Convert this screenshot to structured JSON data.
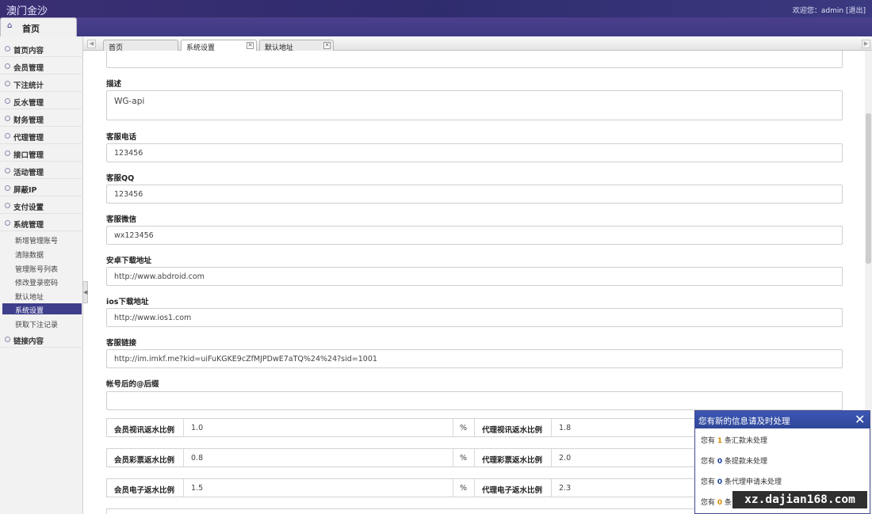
{
  "header": {
    "brand": "澳门金沙",
    "welcome": "欢迎您：admin",
    "logout": "[退出]"
  },
  "home_tab": {
    "label": "首页",
    "icon": "home-icon"
  },
  "sidebar": {
    "items": [
      {
        "label": "首页内容"
      },
      {
        "label": "会员管理"
      },
      {
        "label": "下注统计"
      },
      {
        "label": "反水管理"
      },
      {
        "label": "财务管理"
      },
      {
        "label": "代理管理"
      },
      {
        "label": "接口管理"
      },
      {
        "label": "活动管理"
      },
      {
        "label": "屏蔽IP"
      },
      {
        "label": "支付设置"
      },
      {
        "label": "系统管理"
      }
    ],
    "subitems": [
      {
        "label": "新增管理账号"
      },
      {
        "label": "清除数据"
      },
      {
        "label": "管理账号列表"
      },
      {
        "label": "修改登录密码"
      },
      {
        "label": "默认地址"
      },
      {
        "label": "系统设置"
      },
      {
        "label": "获取下注记录"
      }
    ],
    "active_subitem": "系统设置",
    "last_item": {
      "label": "链接内容"
    },
    "collapse_glyph": "◀"
  },
  "tabs": {
    "left_arrow": "◀",
    "right_arrow": "▶",
    "items": [
      {
        "label": "首页",
        "close": ""
      },
      {
        "label": "系统设置",
        "close": "✕"
      },
      {
        "label": "默认地址",
        "close": "✕"
      }
    ]
  },
  "form": {
    "fields": [
      {
        "label": "描述",
        "value": "WG-api"
      },
      {
        "label": "客服电话",
        "value": "123456"
      },
      {
        "label": "客服QQ",
        "value": "123456"
      },
      {
        "label": "客服微信",
        "value": "wx123456"
      },
      {
        "label": "安卓下载地址",
        "value": "http://www.abdroid.com"
      },
      {
        "label": "ios下载地址",
        "value": "http://www.ios1.com"
      },
      {
        "label": "客服链接",
        "value": "http://im.imkf.me?kid=uiFuKGKE9cZfMJPDwE7aTQ%24%24?sid=1001"
      },
      {
        "label": "帐号后的@后缀",
        "value": ""
      }
    ],
    "rebate_rows": [
      {
        "member_label": "会员视讯返水比例",
        "member_value": "1.0",
        "unit": "%",
        "agent_label": "代理视讯返水比例",
        "agent_value": "1.8"
      },
      {
        "member_label": "会员彩票返水比例",
        "member_value": "0.8",
        "unit": "%",
        "agent_label": "代理彩票返水比例",
        "agent_value": "2.0"
      },
      {
        "member_label": "会员电子返水比例",
        "member_value": "1.5",
        "unit": "%",
        "agent_label": "代理电子返水比例",
        "agent_value": "2.3"
      }
    ]
  },
  "notice": {
    "title": "您有新的信息请及时处理",
    "close": "✕",
    "lines": [
      {
        "prefix": "您有",
        "count": "1",
        "suffix": "条汇款未处理"
      },
      {
        "prefix": "您有",
        "count": "0",
        "suffix": "条提款未处理"
      },
      {
        "prefix": "您有",
        "count": "0",
        "suffix": "条代理申请未处理"
      },
      {
        "prefix": "您有",
        "count": "0",
        "suffix": "条"
      }
    ]
  },
  "watermark": "xz.dajian168.com",
  "colors": {
    "header": "#342e72",
    "active_menu": "#3e3e8c",
    "notice_header": "#3552a8"
  }
}
